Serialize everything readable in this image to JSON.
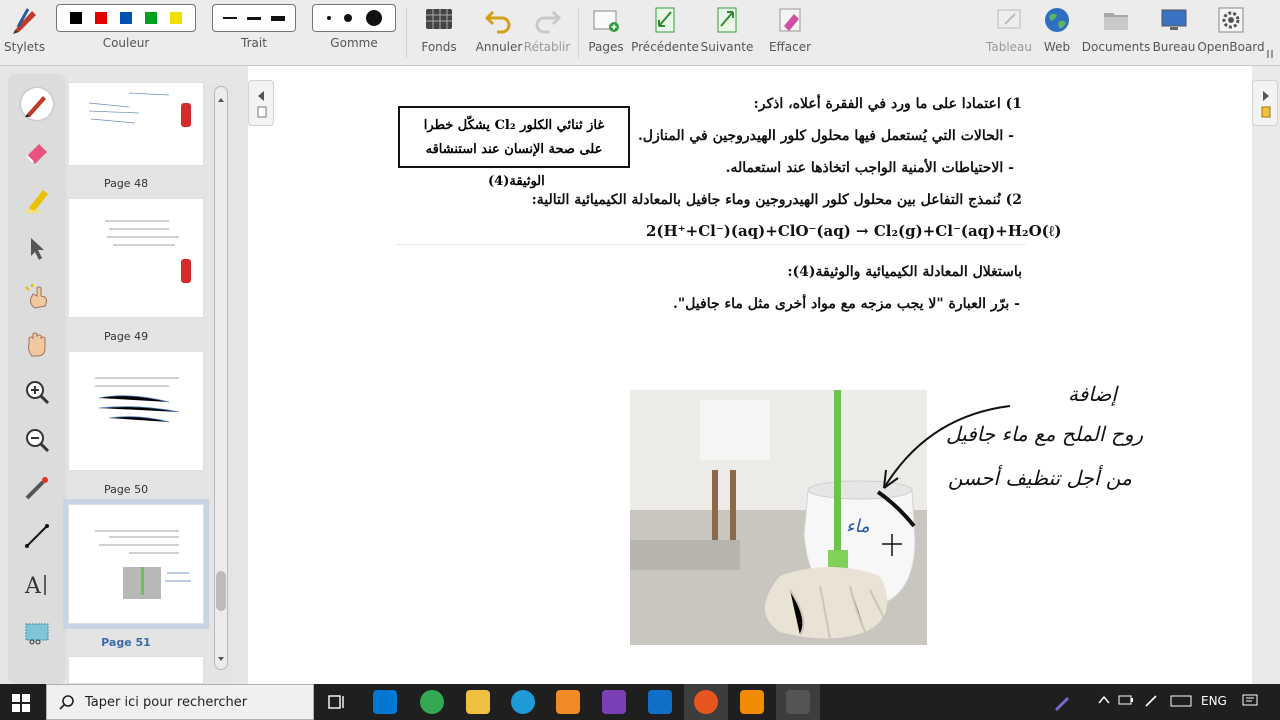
{
  "toolbar": {
    "stylets": "Stylets",
    "couleur": "Couleur",
    "trait": "Trait",
    "gomme": "Gomme",
    "fonds": "Fonds",
    "annuler": "Annuler",
    "retablir": "Rétablir",
    "pages": "Pages",
    "precedente": "Précédente",
    "suivante": "Suivante",
    "effacer": "Effacer",
    "tableau": "Tableau",
    "web": "Web",
    "documents": "Documents",
    "bureau": "Bureau",
    "openboard": "OpenBoard",
    "colors": [
      "#000000",
      "#e00000",
      "#0050b4",
      "#00a020",
      "#f0e000"
    ]
  },
  "thumbnails": [
    {
      "label": "Page 48"
    },
    {
      "label": "Page 49"
    },
    {
      "label": "Page 50"
    },
    {
      "label": "Page 51",
      "selected": true
    }
  ],
  "document": {
    "q1": "1) اعتمادا على ما ورد في الفقرة أعلاه، اذكر:",
    "q1a": "- الحالات التي يُستعمل فيها محلول كلور الهيدروجين في المنازل.",
    "q1b": "- الاحتياطات الأمنية الواجب اتخاذها عند استعماله.",
    "q2": "2) نُنمذج التفاعل بين محلول كلور الهيدروجين وماء جافيل بالمعادلة الكيميائية التالية:",
    "equation": "2(H⁺+Cl⁻)(aq)+ClO⁻(aq) → Cl₂(g)+Cl⁻(aq)+H₂O(ℓ)",
    "using": "باستغلال المعادلة الكيميائية والوثيقة(4):",
    "justify": "- برّر العبارة \"لا يجب مزجه مع مواد أخرى مثل ماء جافيل\".",
    "box_line1": "غاز ثنائي الكلور Cl₂ يشكّل خطرا",
    "box_line2": "على صحة الإنسان عند استنشاقه",
    "doc_label": "الوثيقة(4)"
  },
  "handwriting": {
    "line1": "إضافة",
    "line2": "روح الملح مع ماء جافيل",
    "line3": "من أجل تنظيف أحسن",
    "near_bucket": "ماء"
  },
  "taskbar": {
    "search_placeholder": "Taper ici pour rechercher",
    "lang": "ENG"
  }
}
